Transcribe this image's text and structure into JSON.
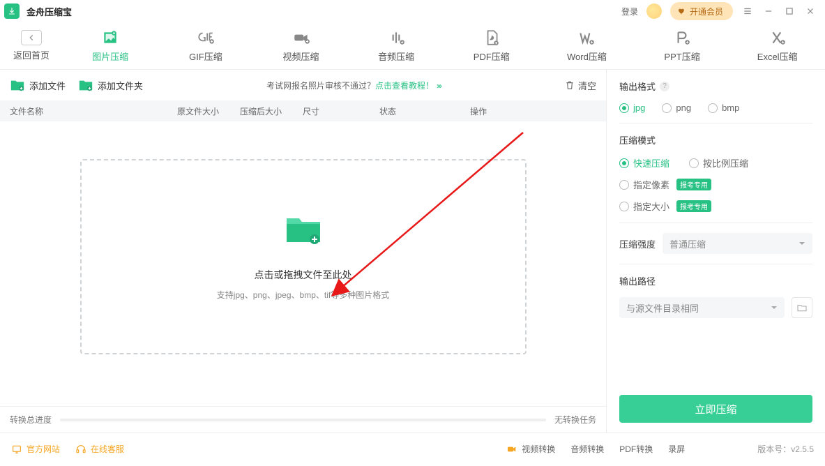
{
  "titlebar": {
    "app_name": "金舟压缩宝",
    "login": "登录",
    "member_btn": "开通会员"
  },
  "tabs": {
    "back": "返回首页",
    "items": [
      {
        "label": "图片压缩"
      },
      {
        "label": "GIF压缩"
      },
      {
        "label": "视频压缩"
      },
      {
        "label": "音频压缩"
      },
      {
        "label": "PDF压缩"
      },
      {
        "label": "Word压缩"
      },
      {
        "label": "PPT压缩"
      },
      {
        "label": "Excel压缩"
      }
    ]
  },
  "toolbar": {
    "add_file": "添加文件",
    "add_folder": "添加文件夹",
    "tip_prefix": "考试网报名照片审核不通过？",
    "tip_link": "点击查看教程！",
    "clear": "清空"
  },
  "columns": [
    "文件名称",
    "原文件大小",
    "压缩后大小",
    "尺寸",
    "状态",
    "操作"
  ],
  "dropzone": {
    "line1": "点击或拖拽文件至此处",
    "line2": "支持jpg、png、jpeg、bmp、tif等多种图片格式"
  },
  "progress": {
    "label": "转换总进度",
    "right": "无转换任务"
  },
  "panel": {
    "output_fmt": {
      "title": "输出格式",
      "opts": [
        "jpg",
        "png",
        "bmp"
      ]
    },
    "mode": {
      "title": "压缩模式",
      "opts": [
        "快速压缩",
        "按比例压缩",
        "指定像素",
        "指定大小"
      ],
      "badge": "报考专用"
    },
    "strength": {
      "title": "压缩强度",
      "value": "普通压缩"
    },
    "path": {
      "title": "输出路径",
      "value": "与源文件目录相同"
    },
    "go": "立即压缩"
  },
  "footer": {
    "official": "官方网站",
    "service": "在线客服",
    "links": [
      "视频转换",
      "音频转换",
      "PDF转换",
      "录屏"
    ],
    "version_label": "版本号：",
    "version": "v2.5.5"
  }
}
